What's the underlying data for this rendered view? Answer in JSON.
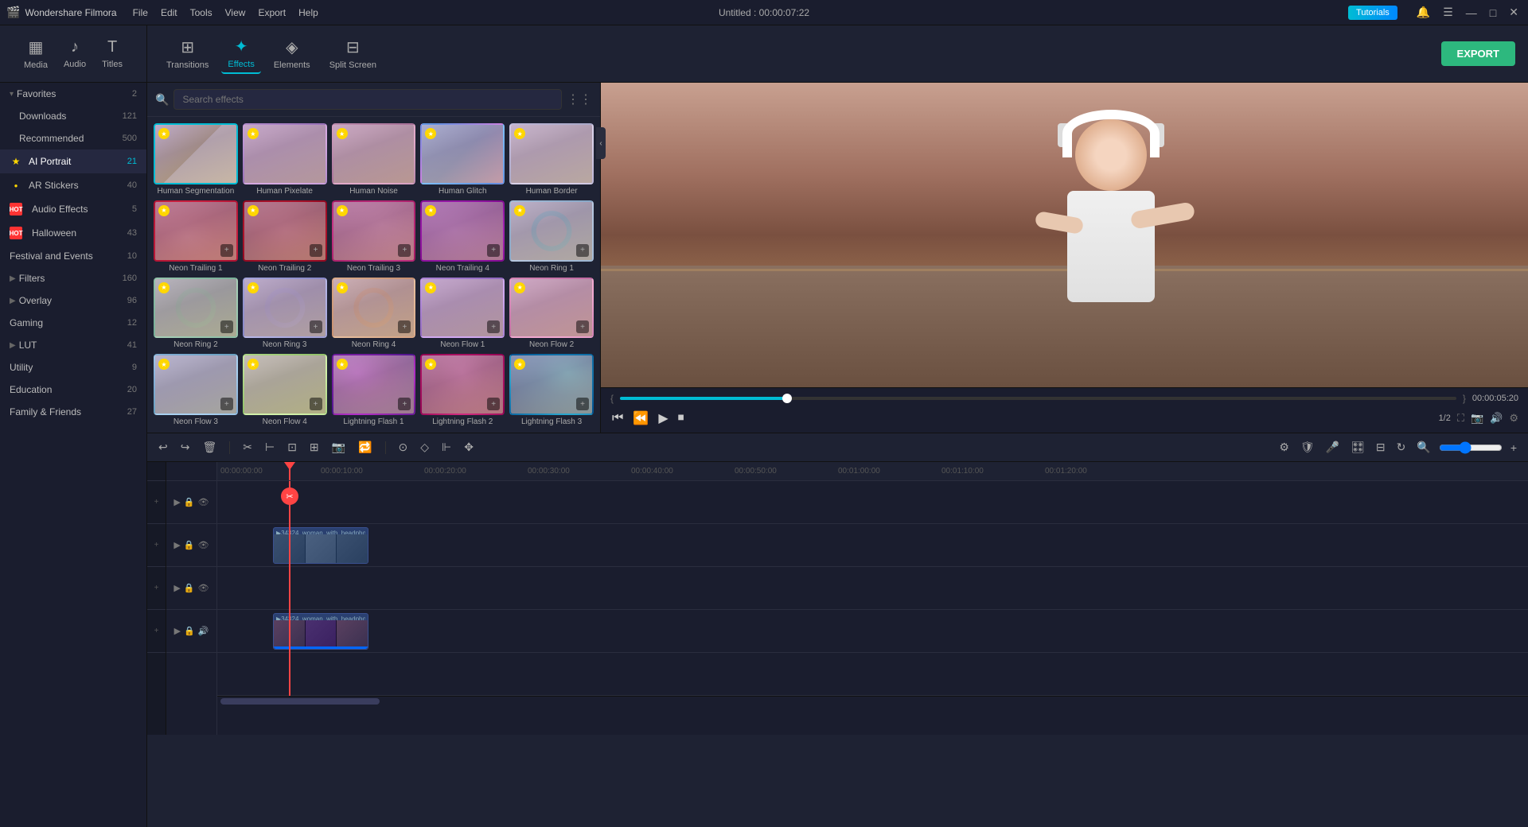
{
  "app": {
    "name": "Wondershare Filmora",
    "title": "Untitled : 00:00:07:22",
    "tutorials_btn": "Tutorials"
  },
  "menu": {
    "items": [
      "File",
      "Edit",
      "Tools",
      "View",
      "Export",
      "Help"
    ]
  },
  "toolbar": {
    "items": [
      {
        "id": "media",
        "icon": "▦",
        "label": "Media"
      },
      {
        "id": "audio",
        "icon": "♪",
        "label": "Audio"
      },
      {
        "id": "titles",
        "icon": "T",
        "label": "Titles"
      },
      {
        "id": "transitions",
        "icon": "⊞",
        "label": "Transitions"
      },
      {
        "id": "effects",
        "icon": "✦",
        "label": "Effects"
      },
      {
        "id": "elements",
        "icon": "◈",
        "label": "Elements"
      },
      {
        "id": "splitscreen",
        "icon": "⊟",
        "label": "Split Screen"
      }
    ],
    "export_btn": "EXPORT"
  },
  "sidebar": {
    "items": [
      {
        "id": "favorites",
        "label": "Favorites",
        "count": "2",
        "icon": "▾",
        "arrow": true
      },
      {
        "id": "downloads",
        "label": "Downloads",
        "count": "121",
        "indent": true
      },
      {
        "id": "recommended",
        "label": "Recommended",
        "count": "500",
        "indent": true
      },
      {
        "id": "ai-portrait",
        "label": "AI Portrait",
        "count": "21",
        "icon": "★",
        "dot": "yellow",
        "active": true
      },
      {
        "id": "ar-stickers",
        "label": "AR Stickers",
        "count": "40",
        "dot": "yellow"
      },
      {
        "id": "audio-effects",
        "label": "Audio Effects",
        "count": "5",
        "dot": "red-hot"
      },
      {
        "id": "halloween",
        "label": "Halloween",
        "count": "43",
        "dot": "red-hot"
      },
      {
        "id": "festival-events",
        "label": "Festival and Events",
        "count": "10"
      },
      {
        "id": "filters",
        "label": "Filters",
        "count": "160",
        "arrow": true
      },
      {
        "id": "overlay",
        "label": "Overlay",
        "count": "96",
        "arrow": true
      },
      {
        "id": "gaming",
        "label": "Gaming",
        "count": "12"
      },
      {
        "id": "lut",
        "label": "LUT",
        "count": "41",
        "arrow": true
      },
      {
        "id": "utility",
        "label": "Utility",
        "count": "9"
      },
      {
        "id": "education",
        "label": "Education",
        "count": "20"
      },
      {
        "id": "family-friends",
        "label": "Family & Friends",
        "count": "27"
      }
    ]
  },
  "effects_panel": {
    "search_placeholder": "Search effects",
    "effects": [
      {
        "id": 1,
        "label": "Human Segmentation",
        "style": "seg",
        "star": true,
        "selected": true
      },
      {
        "id": 2,
        "label": "Human Pixelate",
        "style": "pix",
        "star": true
      },
      {
        "id": 3,
        "label": "Human Noise",
        "style": "noise",
        "star": true
      },
      {
        "id": 4,
        "label": "Human Glitch",
        "style": "glitch",
        "star": true
      },
      {
        "id": 5,
        "label": "Human Border",
        "style": "border",
        "star": true
      },
      {
        "id": 6,
        "label": "Neon Trailing 1",
        "style": "neon1",
        "star": true,
        "plus": true
      },
      {
        "id": 7,
        "label": "Neon Trailing 2",
        "style": "neon2",
        "star": true,
        "plus": true
      },
      {
        "id": 8,
        "label": "Neon Trailing 3",
        "style": "neon3",
        "star": true,
        "plus": true
      },
      {
        "id": 9,
        "label": "Neon Trailing 4",
        "style": "neon4",
        "star": true,
        "plus": true
      },
      {
        "id": 10,
        "label": "Neon Ring 1",
        "style": "ring1",
        "star": true,
        "plus": true
      },
      {
        "id": 11,
        "label": "Neon Ring 2",
        "style": "ring2",
        "star": true,
        "plus": true
      },
      {
        "id": 12,
        "label": "Neon Ring 3",
        "style": "ring3",
        "star": true,
        "plus": true
      },
      {
        "id": 13,
        "label": "Neon Ring 4",
        "style": "ring4",
        "star": true,
        "plus": true
      },
      {
        "id": 14,
        "label": "Neon Flow 1",
        "style": "flow1",
        "star": true,
        "plus": true
      },
      {
        "id": 15,
        "label": "Neon Flow 2",
        "style": "flow2",
        "star": true,
        "plus": true
      },
      {
        "id": 16,
        "label": "Neon Flow 3",
        "style": "flow3",
        "star": true,
        "plus": true
      },
      {
        "id": 17,
        "label": "Neon Flow 4",
        "style": "flow4",
        "star": true,
        "plus": true
      },
      {
        "id": 18,
        "label": "Lightning Flash 1",
        "style": "lightning1",
        "star": true,
        "plus": true
      },
      {
        "id": 19,
        "label": "Lightning Flash 2",
        "style": "lightning2",
        "star": true,
        "plus": true
      },
      {
        "id": 20,
        "label": "Lightning Flash 3",
        "style": "lightning3",
        "star": true,
        "plus": true
      }
    ]
  },
  "preview": {
    "time_display": "00:00:05:20",
    "quality": "1/2",
    "progress_pct": 20
  },
  "timeline": {
    "ruler_marks": [
      "00:00:00:00",
      "00:00:10:00",
      "00:00:20:00",
      "00:00:30:00",
      "00:00:40:00",
      "00:00:50:00",
      "00:01:00:00",
      "00:01:10:00",
      "00:01:20:00"
    ],
    "clips": [
      {
        "id": "clip1",
        "label": "34324_woman_with_headpho",
        "track": 1,
        "start_pct": 8,
        "width_pct": 10
      },
      {
        "id": "clip2",
        "label": "34324_woman_with_headpho",
        "track": 2,
        "start_pct": 8,
        "width_pct": 10
      }
    ]
  },
  "window_controls": {
    "minimize": "—",
    "maximize": "□",
    "close": "✕"
  }
}
